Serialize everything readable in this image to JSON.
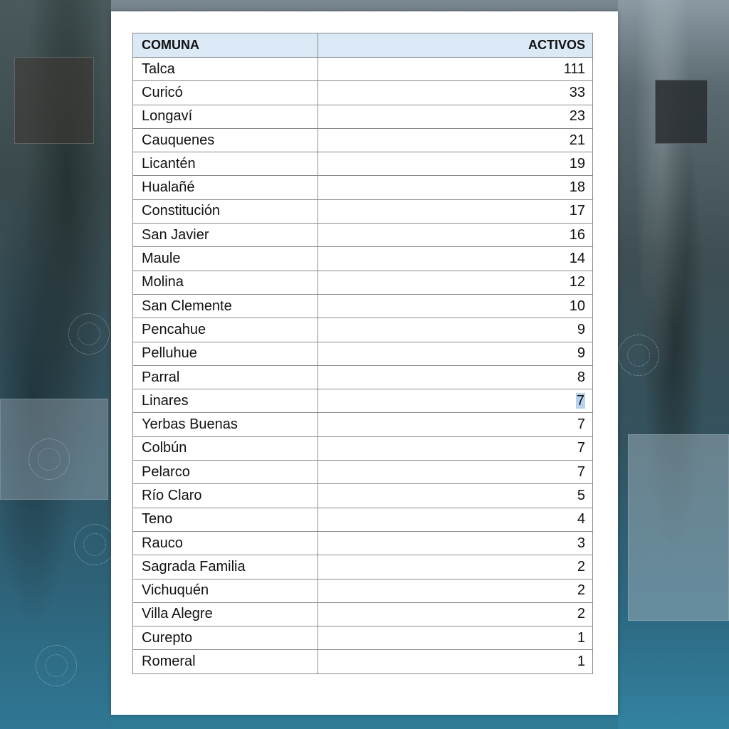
{
  "table": {
    "headers": [
      "COMUNA",
      "ACTIVOS"
    ],
    "rows": [
      [
        "Talca",
        "111"
      ],
      [
        "Curicó",
        "33"
      ],
      [
        "Longaví",
        "23"
      ],
      [
        "Cauquenes",
        "21"
      ],
      [
        "Licantén",
        "19"
      ],
      [
        "Hualañé",
        "18"
      ],
      [
        "Constitución",
        "17"
      ],
      [
        "San Javier",
        "16"
      ],
      [
        "Maule",
        "14"
      ],
      [
        "Molina",
        "12"
      ],
      [
        "San Clemente",
        "10"
      ],
      [
        "Pencahue",
        "9"
      ],
      [
        "Pelluhue",
        "9"
      ],
      [
        "Parral",
        "8"
      ],
      [
        "Linares",
        "7"
      ],
      [
        "Yerbas Buenas",
        "7"
      ],
      [
        "Colbún",
        "7"
      ],
      [
        "Pelarco",
        "7"
      ],
      [
        "Río Claro",
        "5"
      ],
      [
        "Teno",
        "4"
      ],
      [
        "Rauco",
        "3"
      ],
      [
        "Sagrada Familia",
        "2"
      ],
      [
        "Vichuquén",
        "2"
      ],
      [
        "Villa Alegre",
        "2"
      ],
      [
        "Curepto",
        "1"
      ],
      [
        "Romeral",
        "1"
      ]
    ],
    "selected_row_index": 14
  },
  "colors": {
    "header_bg": "#dbe8f6",
    "selection_bg": "#b8d3ee",
    "border": "#8a8a8a"
  }
}
